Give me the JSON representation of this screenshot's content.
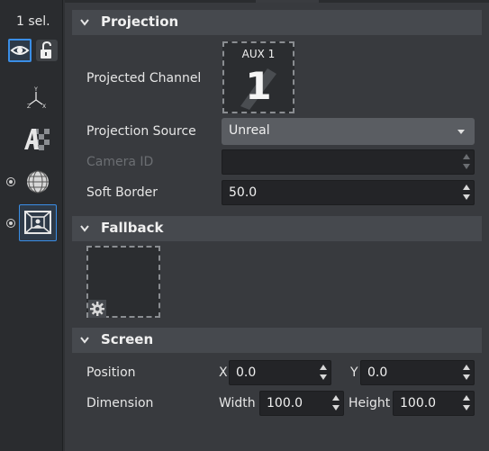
{
  "sidebar": {
    "selection_count": "1 sel.",
    "icons": [
      "eye-icon",
      "lock-icon",
      "axes-icon",
      "alpha-channel-icon",
      "sphere-mesh-icon",
      "projection-icon"
    ]
  },
  "projection": {
    "title": "Projection",
    "projected_channel_label": "Projected Channel",
    "channel_name": "AUX 1",
    "channel_number": "1",
    "projection_source_label": "Projection Source",
    "projection_source_value": "Unreal",
    "camera_id_label": "Camera ID",
    "camera_id_value": "",
    "soft_border_label": "Soft Border",
    "soft_border_value": "50.0"
  },
  "fallback": {
    "title": "Fallback"
  },
  "screen": {
    "title": "Screen",
    "position_label": "Position",
    "x_label": "X",
    "x_value": "0.0",
    "y_label": "Y",
    "y_value": "0.0",
    "dimension_label": "Dimension",
    "width_label": "Width",
    "width_value": "100.0",
    "height_label": "Height",
    "height_value": "100.0"
  },
  "colors": {
    "accent": "#3a8ee6",
    "panel": "#383a3e",
    "section_header": "#46494e",
    "dropdown": "#5a5d62",
    "field": "#232427"
  }
}
